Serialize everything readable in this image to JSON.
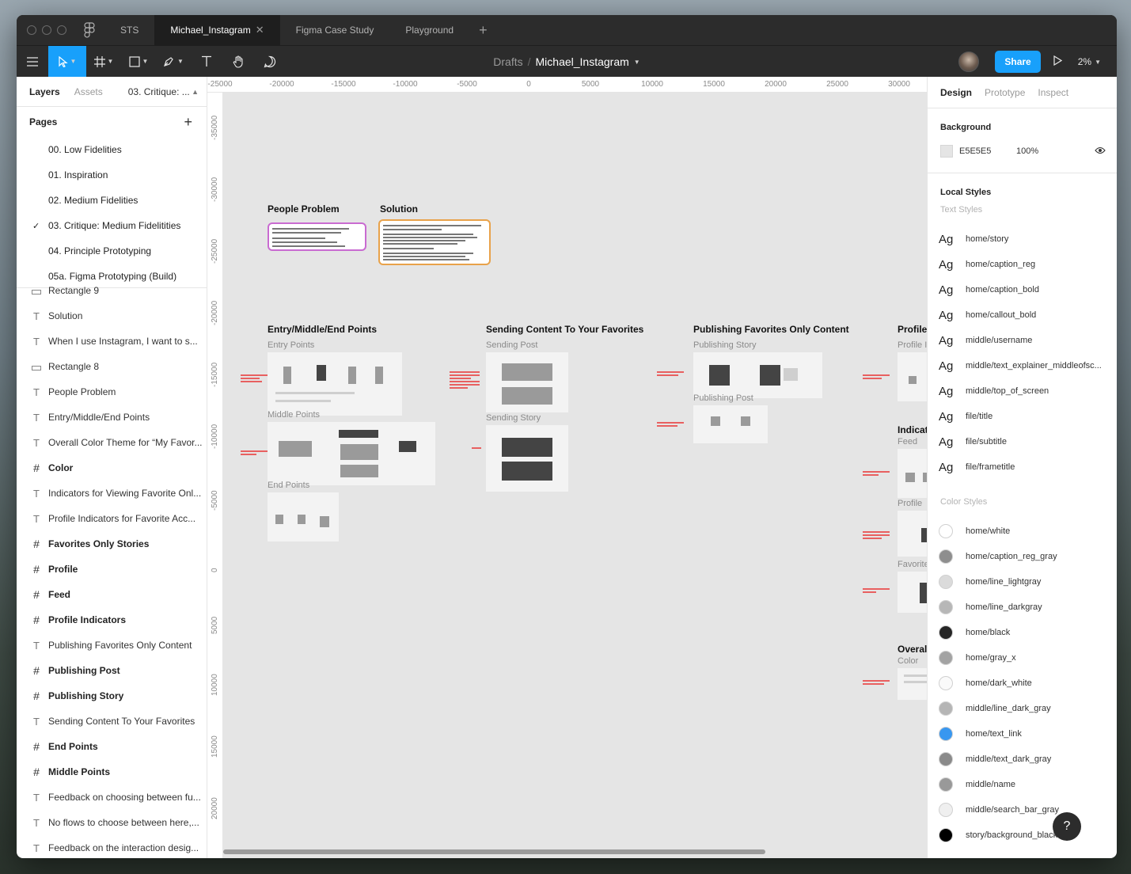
{
  "tabs": [
    {
      "label": "STS",
      "active": false
    },
    {
      "label": "Michael_Instagram",
      "active": true
    },
    {
      "label": "Figma Case Study",
      "active": false
    },
    {
      "label": "Playground",
      "active": false
    }
  ],
  "toolbar": {
    "folder": "Drafts",
    "file_name": "Michael_Instagram",
    "share_label": "Share",
    "zoom": "2%"
  },
  "left_panel": {
    "tab_layers": "Layers",
    "tab_assets": "Assets",
    "current_page": "03. Critique: ...",
    "pages_title": "Pages",
    "pages": [
      {
        "label": "00. Low Fidelities",
        "checked": false
      },
      {
        "label": "01. Inspiration",
        "checked": false
      },
      {
        "label": "02. Medium Fidelities",
        "checked": false
      },
      {
        "label": "03. Critique: Medium Fidelitities",
        "checked": true
      },
      {
        "label": "04. Principle Prototyping",
        "checked": false
      },
      {
        "label": "05a. Figma Prototyping (Build)",
        "checked": false
      }
    ],
    "layers": [
      {
        "label": "Rectangle 9",
        "type": "rect"
      },
      {
        "label": "Solution",
        "type": "text"
      },
      {
        "label": "When I use Instagram, I want to s...",
        "type": "text"
      },
      {
        "label": "Rectangle 8",
        "type": "rect"
      },
      {
        "label": "People Problem",
        "type": "text"
      },
      {
        "label": "Entry/Middle/End Points",
        "type": "text"
      },
      {
        "label": "Overall Color Theme for “My Favor...",
        "type": "text"
      },
      {
        "label": "Color",
        "type": "frame"
      },
      {
        "label": "Indicators for Viewing Favorite Onl...",
        "type": "text"
      },
      {
        "label": "Profile Indicators for Favorite Acc...",
        "type": "text"
      },
      {
        "label": "Favorites Only Stories",
        "type": "frame"
      },
      {
        "label": "Profile",
        "type": "frame"
      },
      {
        "label": "Feed",
        "type": "frame"
      },
      {
        "label": "Profile Indicators",
        "type": "frame"
      },
      {
        "label": "Publishing Favorites Only Content",
        "type": "text"
      },
      {
        "label": "Publishing Post",
        "type": "frame"
      },
      {
        "label": "Publishing Story",
        "type": "frame"
      },
      {
        "label": "Sending Content To Your Favorites",
        "type": "text"
      },
      {
        "label": "End Points",
        "type": "frame"
      },
      {
        "label": "Middle Points",
        "type": "frame"
      },
      {
        "label": "Feedback on choosing between fu...",
        "type": "text"
      },
      {
        "label": "No flows to choose between here,...",
        "type": "text"
      },
      {
        "label": "Feedback on the interaction desig...",
        "type": "text"
      }
    ]
  },
  "canvas": {
    "ruler_top": [
      "-25000",
      "-20000",
      "-15000",
      "-10000",
      "-5000",
      "0",
      "5000",
      "10000",
      "15000",
      "20000",
      "25000",
      "30000"
    ],
    "ruler_left": [
      "-35000",
      "-30000",
      "-25000",
      "-20000",
      "-15000",
      "-10000",
      "-5000",
      "0",
      "5000",
      "10000",
      "15000",
      "20000"
    ],
    "people_problem": "People Problem",
    "solution": "Solution",
    "entry_section": "Entry/Middle/End Points",
    "entry_points": "Entry Points",
    "middle_points": "Middle Points",
    "end_points": "End Points",
    "sending_section": "Sending Content To Your Favorites",
    "sending_post": "Sending Post",
    "sending_story": "Sending Story",
    "publishing_section": "Publishing Favorites Only Content",
    "publishing_story": "Publishing Story",
    "publishing_post": "Publishing Post",
    "profile_ind_section": "Profile Ind",
    "profile_ind_sub": "Profile Indic",
    "indicators_section": "Indicators",
    "feed_sub": "Feed",
    "profile_sub": "Profile",
    "favorites_sub": "Favorites C",
    "overall_section": "Overall Co",
    "color_sub": "Color"
  },
  "right_panel": {
    "tab_design": "Design",
    "tab_prototype": "Prototype",
    "tab_inspect": "Inspect",
    "background_title": "Background",
    "background_hex": "E5E5E5",
    "background_color": "#E5E5E5",
    "background_opacity": "100%",
    "local_styles_title": "Local Styles",
    "text_styles_title": "Text Styles",
    "text_styles": [
      "home/story",
      "home/caption_reg",
      "home/caption_bold",
      "home/callout_bold",
      "middle/username",
      "middle/text_explainer_middleofsc...",
      "middle/top_of_screen",
      "file/title",
      "file/subtitle",
      "file/frametitle"
    ],
    "text_style_glyph": "Ag",
    "color_styles_title": "Color Styles",
    "color_styles": [
      {
        "name": "home/white",
        "color": "#FFFFFF"
      },
      {
        "name": "home/caption_reg_gray",
        "color": "#8E8E8E"
      },
      {
        "name": "home/line_lightgray",
        "color": "#DBDBDB"
      },
      {
        "name": "home/line_darkgray",
        "color": "#B7B7B7"
      },
      {
        "name": "home/black",
        "color": "#262626"
      },
      {
        "name": "home/gray_x",
        "color": "#A3A3A3"
      },
      {
        "name": "home/dark_white",
        "color": "#FAFAFA"
      },
      {
        "name": "middle/line_dark_gray",
        "color": "#B5B5B5"
      },
      {
        "name": "home/text_link",
        "color": "#3897F0"
      },
      {
        "name": "middle/text_dark_gray",
        "color": "#8A8A8A"
      },
      {
        "name": "middle/name",
        "color": "#999999"
      },
      {
        "name": "middle/search_bar_gray",
        "color": "#EFEFEF"
      },
      {
        "name": "story/background_black",
        "color": "#000000"
      }
    ]
  },
  "help_label": "?"
}
